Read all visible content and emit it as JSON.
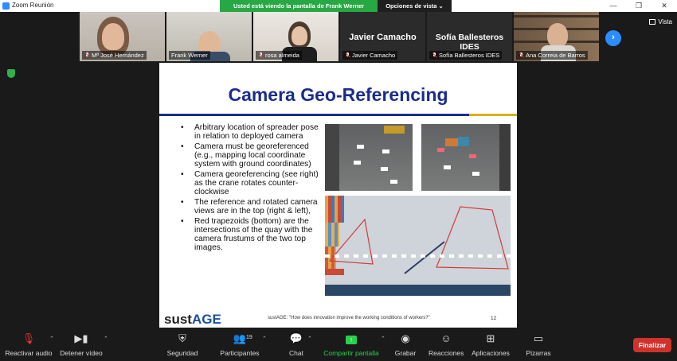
{
  "window": {
    "title": "Zoom Reunión",
    "controls": [
      "—",
      "❐",
      "✕"
    ]
  },
  "banner": {
    "text": "Usted está viendo la pantalla de Frank Werner",
    "view_options": "Opciones de vista ⌄"
  },
  "participants": [
    {
      "name": "Mª José Hernández"
    },
    {
      "name": "Frank Werner",
      "active": true
    },
    {
      "name": "rosa almeida"
    },
    {
      "name": "Javier Camacho",
      "big_name": "Javier Camacho"
    },
    {
      "name": "Sofía Ballesteros IDES",
      "big_name": "Sofía Ballesteros IDES"
    },
    {
      "name": "Ana Correia de Barros"
    }
  ],
  "view": {
    "label": "Vista"
  },
  "slide": {
    "title": "Camera Geo-Referencing",
    "bullets": [
      "Arbitrary location of spreader pose in relation to deployed camera",
      "Camera must be georeferenced (e.g., mapping local coordinate system with ground coordinates)",
      "Camera georeferencing (see right) as the crane rotates counter-clockwise",
      "The reference and rotated camera views are in the top (right & left),",
      "Red trapezoids (bottom) are the intersections of the quay with the camera frustums of the two top images."
    ],
    "logo_prefix": "sust",
    "logo_suffix": "AGE",
    "footer": "sustAGE: \"How does innovation improve the working conditions of workers?\"",
    "page_number": "12"
  },
  "toolbar": {
    "unmute": "Reactivar audio",
    "stop_video": "Detener vídeo",
    "security": "Seguridad",
    "participants": "Participantes",
    "participants_count": "19",
    "chat": "Chat",
    "share": "Compartir pantalla",
    "record": "Grabar",
    "reactions": "Reacciones",
    "apps": "Aplicaciones",
    "whiteboards": "Pizarras",
    "finish": "Finalizar"
  },
  "colors": {
    "accent": "#2d8cff",
    "share_green": "#28a745",
    "end_red": "#d0322b",
    "slide_title": "#1a2d8c"
  }
}
